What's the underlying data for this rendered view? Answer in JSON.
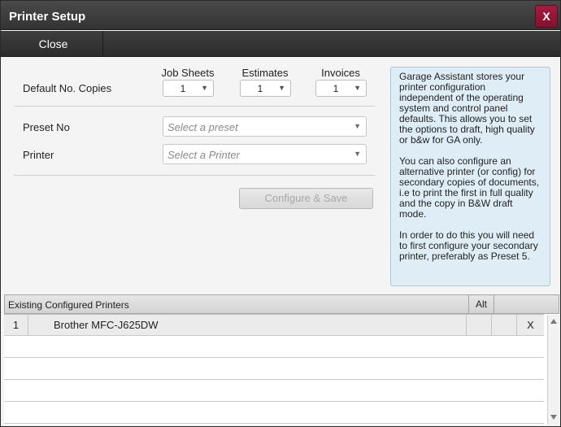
{
  "dialog": {
    "title": "Printer Setup",
    "close_x": "X"
  },
  "toolbar": {
    "close_label": "Close"
  },
  "copies": {
    "label": "Default No. Copies",
    "job_sheets": {
      "header": "Job Sheets",
      "value": "1"
    },
    "estimates": {
      "header": "Estimates",
      "value": "1"
    },
    "invoices": {
      "header": "Invoices",
      "value": "1"
    }
  },
  "preset": {
    "label": "Preset No",
    "placeholder": "Select a preset"
  },
  "printer": {
    "label": "Printer",
    "placeholder": "Select a Printer"
  },
  "configure_button": "Configure & Save",
  "info": {
    "p1": "Garage Assistant stores your printer configuration independent of the operating system and control panel defaults.  This allows you to set the options to draft, high quality or b&w for GA only.",
    "p2": "You can also configure an alternative printer (or config) for secondary copies of documents, i.e to print the first in full quality and the copy in B&W draft mode.",
    "p3": "In order to do this you will need to first configure your secondary printer, preferably as Preset 5."
  },
  "grid": {
    "title": "Existing Configured Printers",
    "alt_header": "Alt",
    "rows": [
      {
        "index": "1",
        "name": "Brother MFC-J625DW",
        "delete": "X"
      }
    ]
  },
  "icons": {
    "dropdown": "chevron-down-icon",
    "scroll_up": "arrow-up-icon",
    "scroll_down": "arrow-down-icon"
  },
  "colors": {
    "close_button": "#a51c3f",
    "info_panel": "#dfeef6",
    "titlebar": "#3a3a3a"
  }
}
